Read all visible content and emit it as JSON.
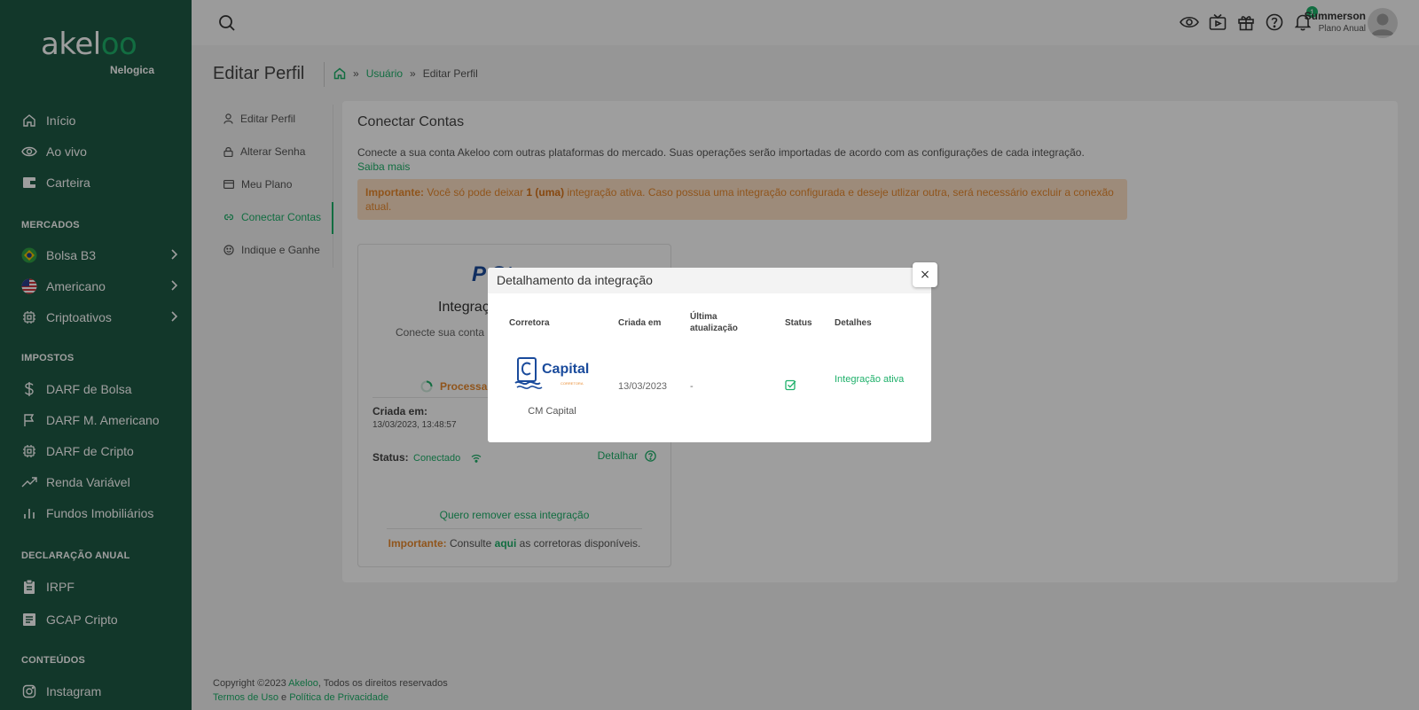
{
  "sidebar": {
    "logo_main": "akeloo",
    "logo_sub": "Nelogica",
    "nav_top": [
      {
        "label": "Início",
        "icon": "home-icon"
      },
      {
        "label": "Ao vivo",
        "icon": "eye-icon"
      },
      {
        "label": "Carteira",
        "icon": "wallet-icon"
      }
    ],
    "sections": {
      "mercados": "MERCADOS",
      "impostos": "IMPOSTOS",
      "declaracao": "DECLARAÇÃO ANUAL",
      "conteudos": "CONTEÚDOS"
    },
    "mercados": [
      {
        "label": "Bolsa B3",
        "icon": "brazil-flag-icon"
      },
      {
        "label": "Americano",
        "icon": "usa-flag-icon"
      },
      {
        "label": "Criptoativos",
        "icon": "chip-icon"
      }
    ],
    "impostos": [
      {
        "label": "DARF de Bolsa",
        "icon": "dollar-icon"
      },
      {
        "label": "DARF M. Americano",
        "icon": "flag-icon"
      },
      {
        "label": "DARF de Cripto",
        "icon": "chip-icon"
      },
      {
        "label": "Renda Variável",
        "icon": "trend-up-icon"
      },
      {
        "label": "Fundos Imobiliários",
        "icon": "bar-chart-icon"
      }
    ],
    "declaracao": [
      {
        "label": "IRPF",
        "icon": "clipboard-icon"
      },
      {
        "label": "GCAP Cripto",
        "icon": "document-icon"
      }
    ],
    "conteudos": [
      {
        "label": "Instagram",
        "icon": "instagram-icon"
      }
    ]
  },
  "topbar": {
    "notification_count": "1",
    "user_name": "Summerson",
    "user_plan": "Plano Anual"
  },
  "header": {
    "title": "Editar Perfil",
    "breadcrumb": [
      "Usuário",
      "Editar Perfil"
    ]
  },
  "profile_nav": [
    {
      "label": "Editar Perfil",
      "icon": "user-icon"
    },
    {
      "label": "Alterar Senha",
      "icon": "lock-icon"
    },
    {
      "label": "Meu Plano",
      "icon": "card-icon"
    },
    {
      "label": "Conectar Contas",
      "icon": "link-icon"
    },
    {
      "label": "Indique e Ganhe",
      "icon": "smile-icon"
    }
  ],
  "main": {
    "title": "Conectar Contas",
    "description": "Conecte a sua conta Akeloo com outras plataformas do mercado. Suas operações serão importadas de acordo com as configurações de cada integração.",
    "learn_more": "Saiba mais",
    "alert_strong": "Importante:",
    "alert_text_1": " Você só pode deixar ",
    "alert_bold": "1 (uma)",
    "alert_text_2": " integração ativa. Caso possua uma integração configurada e deseje utlizar outra, será necessário excluir a conexão atual."
  },
  "integration_card": {
    "logo_text": "P    St",
    "title": "Integraç",
    "desc": "Conecte sua conta",
    "processing": "Processa",
    "created_label": "Criada em:",
    "created_value": "13/03/2023, 13:48:57",
    "status_label": "Status:",
    "status_value": "Conectado",
    "detail_link": "Detalhar",
    "remove_link": "Quero remover essa integração",
    "note_strong": "Importante:",
    "note_text_1": " Consulte ",
    "note_link": "aqui",
    "note_text_2": " as corretoras disponíveis."
  },
  "footer": {
    "copyright_pre": "Copyright ©2023 ",
    "brand": "Akeloo",
    "copyright_post": ", Todos os direitos reservados",
    "terms": "Termos de Uso",
    "and": " e ",
    "privacy": "Política de Privacidade"
  },
  "modal": {
    "title": "Detalhamento da integração",
    "close": "×",
    "columns": [
      "Corretora",
      "Criada em",
      "Última atualização",
      "Status",
      "Detalhes"
    ],
    "row": {
      "broker_logo": "Capital",
      "broker_logo_sub": "CORRETORA",
      "broker_name": "CM Capital",
      "created": "13/03/2023",
      "updated": "-",
      "status_icon": "check-square-icon",
      "details": "Integração ativa"
    }
  },
  "colors": {
    "sidebar": "#1e5a44",
    "accent": "#1eb06a",
    "warning": "#e88a2e",
    "alert_bg": "#fde0c6"
  }
}
